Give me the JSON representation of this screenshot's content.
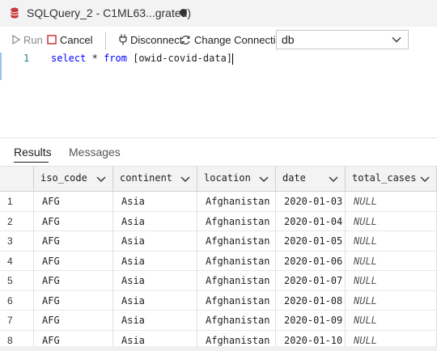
{
  "tab": {
    "title": "SQLQuery_2 - C1ML63...grated)",
    "icon": "database-icon",
    "dirty": true
  },
  "toolbar": {
    "run_label": "Run",
    "cancel_label": "Cancel",
    "disconnect_label": "Disconnect",
    "change_connection_label": "Change Connection",
    "database_value": "db"
  },
  "editor": {
    "line_number": "1",
    "tokens": {
      "select": "select",
      "star": "*",
      "from": "from",
      "table": "[owid-covid-data]"
    }
  },
  "results_tabs": {
    "results": "Results",
    "messages": "Messages",
    "active": "Results"
  },
  "grid": {
    "columns": [
      "iso_code",
      "continent",
      "location",
      "date",
      "total_cases"
    ],
    "rows": [
      [
        "1",
        "AFG",
        "Asia",
        "Afghanistan",
        "2020-01-03",
        "NULL"
      ],
      [
        "2",
        "AFG",
        "Asia",
        "Afghanistan",
        "2020-01-04",
        "NULL"
      ],
      [
        "3",
        "AFG",
        "Asia",
        "Afghanistan",
        "2020-01-05",
        "NULL"
      ],
      [
        "4",
        "AFG",
        "Asia",
        "Afghanistan",
        "2020-01-06",
        "NULL"
      ],
      [
        "5",
        "AFG",
        "Asia",
        "Afghanistan",
        "2020-01-07",
        "NULL"
      ],
      [
        "6",
        "AFG",
        "Asia",
        "Afghanistan",
        "2020-01-08",
        "NULL"
      ],
      [
        "7",
        "AFG",
        "Asia",
        "Afghanistan",
        "2020-01-09",
        "NULL"
      ],
      [
        "8",
        "AFG",
        "Asia",
        "Afghanistan",
        "2020-01-10",
        "NULL"
      ]
    ]
  },
  "colors": {
    "keyword": "#0000ff",
    "line_number": "#237893",
    "tab_bg": "#f3f3f3"
  }
}
